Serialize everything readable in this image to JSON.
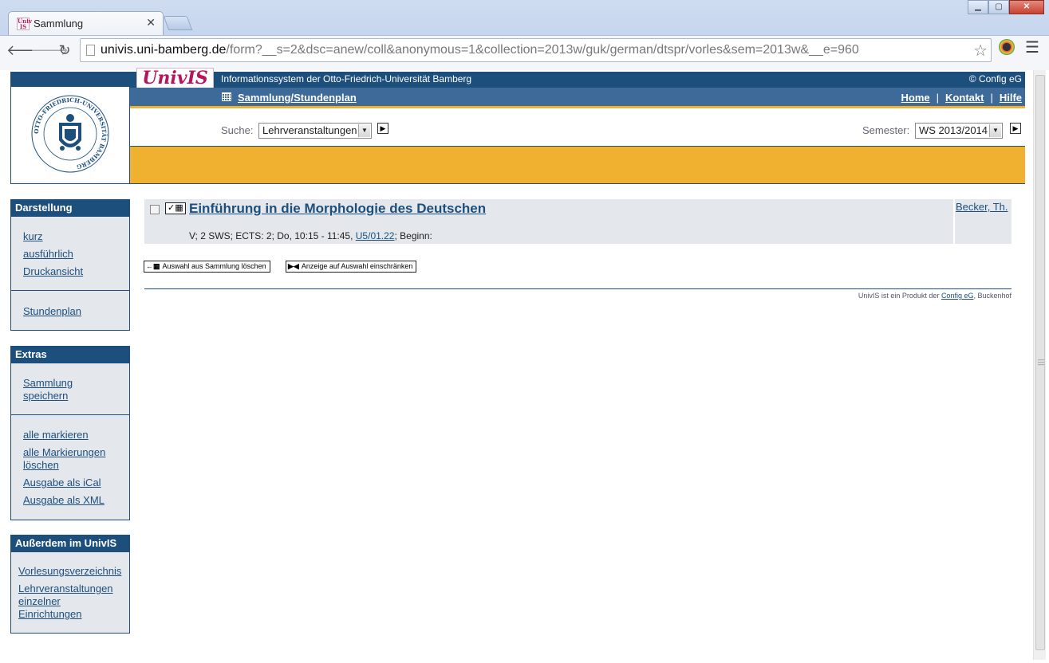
{
  "browser": {
    "tab_title": "Sammlung",
    "tab_favicon": "UnivIS",
    "url_host": "univis.uni-bamberg.de",
    "url_path": "/form?__s=2&dsc=anew/coll&anonymous=1&collection=2013w/guk/german/dtspr/vorles&sem=2013w&__e=960"
  },
  "header": {
    "logo": "UnivIS",
    "title": "Informationssystem der Otto-Friedrich-Universität Bamberg",
    "copyright": "© Config eG",
    "breadcrumb": "Sammlung/Stundenplan",
    "links": [
      "Home",
      "Kontakt",
      "Hilfe"
    ],
    "seal_text": "OTTO-FRIEDRICH-UNIVERSITÄT BAMBERG"
  },
  "search": {
    "label": "Suche:",
    "value": "Lehrveranstaltungen",
    "semester_label": "Semester:",
    "semester_value": "WS 2013/2014"
  },
  "sidebar": {
    "darstellung": {
      "title": "Darstellung",
      "group1": [
        "kurz",
        "ausführlich",
        "Druckansicht"
      ],
      "group2": [
        "Stundenplan"
      ]
    },
    "extras": {
      "title": "Extras",
      "group1_line1": "Sammlung",
      "group1_line2": "speichern",
      "markall": "alle markieren",
      "unmark_line1": "alle Markierungen",
      "unmark_line2": "löschen",
      "ical": "Ausgabe als iCal",
      "xml": "Ausgabe als XML"
    },
    "ausserdem": {
      "title": "Außerdem im UnivIS",
      "vv": "Vorlesungsverzeichnis",
      "lv_line1": "Lehrveranstaltungen",
      "lv_line2": "einzelner",
      "lv_line3": "Einrichtungen"
    }
  },
  "main": {
    "course_title": "Einführung in die Morphologie des Deutschen",
    "course_info_prefix": "V; 2 SWS; ECTS: 2; Do, 10:15 - 11:45, ",
    "course_room": "U5/01.22",
    "course_info_suffix": "; Beginn:",
    "lecturer": "Becker, Th.",
    "btn_delete": "Auswahl aus Sammlung löschen",
    "btn_restrict": "Anzeige auf Auswahl einschränken",
    "footer_prefix": "UnivIS ist ein Produkt der ",
    "footer_link": "Config eG",
    "footer_suffix": ", Buckenhof"
  },
  "colors": {
    "brand_blue": "#1d4f7d",
    "nav_blue": "#3d6a98",
    "accent_orange": "#f0b030",
    "logo_magenta": "#b8145c"
  }
}
